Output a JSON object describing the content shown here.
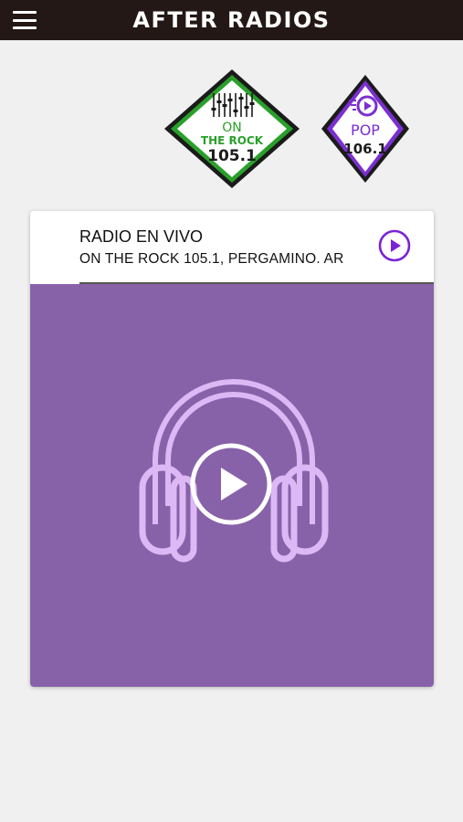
{
  "header": {
    "title": "AFTER RADIOS",
    "menu_icon": "hamburger-menu-icon"
  },
  "stations": [
    {
      "name": "ON THE ROCK",
      "line1": "ON",
      "line2": "THE ROCK",
      "frequency": "105.1",
      "color": "#2aa02a"
    },
    {
      "name": "POP",
      "frequency": "106.1",
      "color": "#7b2fd0"
    }
  ],
  "player": {
    "title": "RADIO EN VIVO",
    "station": "ON THE ROCK 105.1, PERGAMINO. AR",
    "play_icon": "play-circle-icon",
    "art_icon": "headphones-icon",
    "accent_color": "#7a22d6",
    "art_background": "#8862a9"
  }
}
